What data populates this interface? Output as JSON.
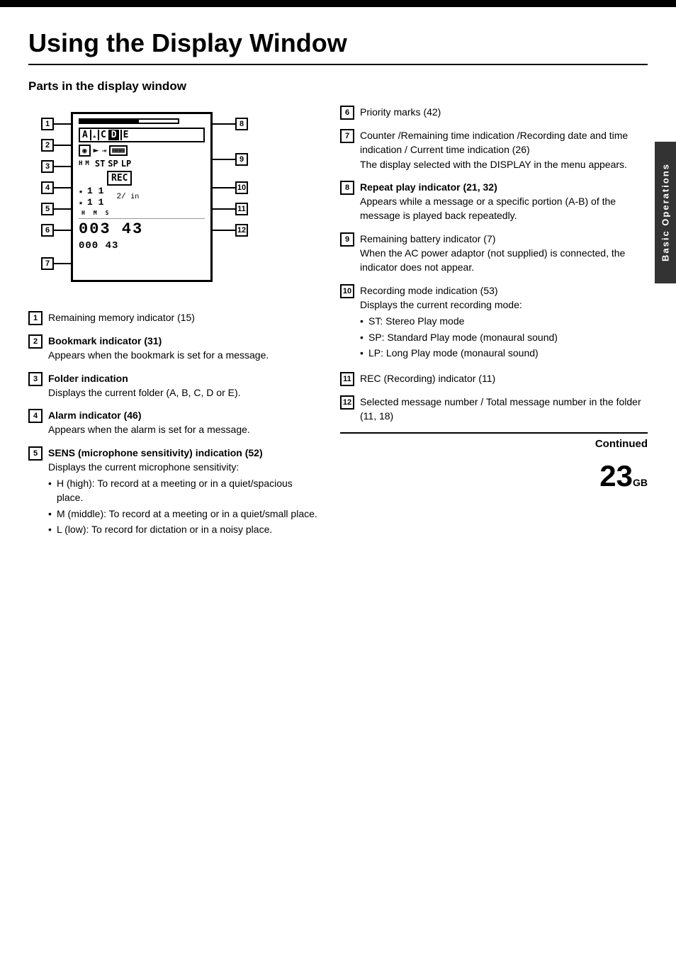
{
  "page": {
    "title": "Using the Display Window",
    "section": "Parts in the display window",
    "sidebar_label": "Basic Operations",
    "continued": "Continued",
    "page_number": "23",
    "page_suffix": "GB"
  },
  "left_items": [
    {
      "num": "1",
      "title": "Remaining memory indicator (15)"
    },
    {
      "num": "2",
      "title": "Bookmark indicator (31)",
      "desc": "Appears when the bookmark is set for a message."
    },
    {
      "num": "3",
      "title": "Folder indication",
      "desc": "Displays the current folder (A, B, C, D or E)."
    },
    {
      "num": "4",
      "title": "Alarm indicator (46)",
      "desc": "Appears when the alarm is set for a message."
    },
    {
      "num": "5",
      "title": "SENS (microphone sensitivity) indication (52)",
      "desc": "Displays the current microphone sensitivity:",
      "bullets": [
        "H (high): To record at a meeting or in a quiet/spacious place.",
        "M (middle): To record at a meeting or in a quiet/small place.",
        "L (low): To record for dictation or in a noisy place."
      ]
    }
  ],
  "right_items": [
    {
      "num": "6",
      "title": "Priority marks (42)"
    },
    {
      "num": "7",
      "title": "Counter /Remaining time indication /Recording date and time indication / Current time indication (26)",
      "desc": "The display selected with the DISPLAY in the menu appears."
    },
    {
      "num": "8",
      "title": "Repeat play indicator (21, 32)",
      "desc": "Appears while a message or a specific portion (A-B) of the message is played back repeatedly."
    },
    {
      "num": "9",
      "title": "Remaining battery indicator (7)",
      "desc": "When the AC power adaptor (not supplied) is connected, the indicator does not appear."
    },
    {
      "num": "10",
      "title": "Recording mode indication (53)",
      "desc": "Displays the current recording mode:",
      "bullets": [
        "ST: Stereo Play mode",
        "SP: Standard Play mode (monaural sound)",
        "LP: Long Play mode (monaural sound)"
      ]
    },
    {
      "num": "11",
      "title": "REC (Recording) indicator (11)"
    },
    {
      "num": "12",
      "title": "Selected message number / Total message number in the folder (11, 18)"
    }
  ]
}
